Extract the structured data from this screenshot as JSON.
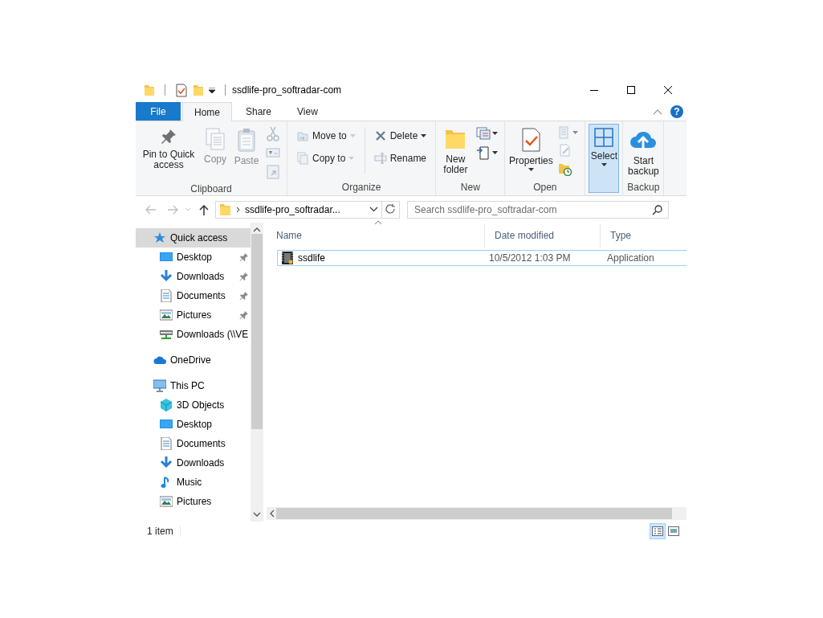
{
  "window": {
    "title": "ssdlife-pro_softradar-com"
  },
  "ribbon_tabs": [
    {
      "label": "File",
      "kind": "file",
      "selected": false
    },
    {
      "label": "Home",
      "kind": "tab",
      "selected": true
    },
    {
      "label": "Share",
      "kind": "tab",
      "selected": false
    },
    {
      "label": "View",
      "kind": "tab",
      "selected": false
    }
  ],
  "help_button": "?",
  "ribbon_groups": [
    {
      "label": "Clipboard",
      "commands": [
        {
          "kind": "large",
          "label": "Pin to Quick access",
          "disabled": false,
          "pressed": false,
          "dropdown": false
        },
        {
          "kind": "large",
          "label": "Copy",
          "disabled": true,
          "pressed": false,
          "dropdown": false
        },
        {
          "kind": "large",
          "label": "Paste",
          "disabled": true,
          "pressed": false,
          "dropdown": false
        },
        {
          "kind": "icon",
          "disabled": true,
          "pressed": false,
          "dropdown": false
        },
        {
          "kind": "icon",
          "disabled": true,
          "pressed": false,
          "dropdown": false
        },
        {
          "kind": "icon",
          "disabled": true,
          "pressed": false,
          "dropdown": false
        }
      ]
    },
    {
      "label": "Organize",
      "commands": [
        {
          "kind": "small",
          "label": "Move to",
          "disabled": true,
          "pressed": false,
          "dropdown": true
        },
        {
          "kind": "small",
          "label": "Copy to",
          "disabled": true,
          "pressed": false,
          "dropdown": true
        },
        {
          "kind": "small",
          "label": "Delete",
          "disabled": false,
          "pressed": false,
          "dropdown": true
        },
        {
          "kind": "small",
          "label": "Rename",
          "disabled": true,
          "pressed": false,
          "dropdown": false
        }
      ]
    },
    {
      "label": "New",
      "commands": [
        {
          "kind": "large",
          "label": "New folder",
          "disabled": false,
          "pressed": false,
          "dropdown": false
        },
        {
          "kind": "icon",
          "disabled": false,
          "pressed": false,
          "dropdown": true
        },
        {
          "kind": "icon",
          "disabled": false,
          "pressed": false,
          "dropdown": true
        }
      ]
    },
    {
      "label": "Open",
      "commands": [
        {
          "kind": "large",
          "label": "Properties",
          "disabled": false,
          "pressed": false,
          "dropdown": true
        },
        {
          "kind": "icon",
          "disabled": true,
          "pressed": false,
          "dropdown": true
        },
        {
          "kind": "icon",
          "disabled": true,
          "pressed": false,
          "dropdown": false
        },
        {
          "kind": "icon",
          "disabled": false,
          "pressed": false,
          "dropdown": false
        }
      ]
    },
    {
      "commands": [
        {
          "kind": "large",
          "label": "Select",
          "disabled": false,
          "pressed": true,
          "dropdown": true
        }
      ]
    },
    {
      "label": "Backup",
      "commands": [
        {
          "kind": "large",
          "label": "Start backup",
          "disabled": false,
          "pressed": false,
          "dropdown": false
        }
      ]
    }
  ],
  "address_bar": {
    "path": "ssdlife-pro_softradar..."
  },
  "search": {
    "placeholder": "Search ssdlife-pro_softradar-com"
  },
  "sidebar": {
    "items": [
      {
        "label": "Quick access",
        "kind": "quick",
        "selected": true,
        "pinned": false,
        "children": [
          {
            "label": "Desktop",
            "kind": "desktop",
            "selected": false,
            "pinned": true
          },
          {
            "label": "Downloads",
            "kind": "downloads",
            "selected": false,
            "pinned": true
          },
          {
            "label": "Documents",
            "kind": "documents",
            "selected": false,
            "pinned": true
          },
          {
            "label": "Pictures",
            "kind": "pictures",
            "selected": false,
            "pinned": true
          },
          {
            "label": "Downloads (\\\\VE",
            "kind": "network",
            "selected": false,
            "pinned": false
          }
        ]
      },
      {
        "label": "OneDrive",
        "kind": "onedrive",
        "selected": false,
        "pinned": false
      },
      {
        "label": "This PC",
        "kind": "pc",
        "selected": false,
        "pinned": false,
        "children": [
          {
            "label": "3D Objects",
            "kind": "objects",
            "selected": false,
            "pinned": false
          },
          {
            "label": "Desktop",
            "kind": "desktop",
            "selected": false,
            "pinned": false
          },
          {
            "label": "Documents",
            "kind": "documents",
            "selected": false,
            "pinned": false
          },
          {
            "label": "Downloads",
            "kind": "downloads",
            "selected": false,
            "pinned": false
          },
          {
            "label": "Music",
            "kind": "music",
            "selected": false,
            "pinned": false
          },
          {
            "label": "Pictures",
            "kind": "pictures",
            "selected": false,
            "pinned": false
          }
        ]
      }
    ]
  },
  "file_list": {
    "columns": [
      "Name",
      "Date modified",
      "Type"
    ],
    "rows": [
      {
        "name": "ssdlife",
        "date_modified": "10/5/2012 1:03 PM",
        "type": "Application",
        "selected": false,
        "focused": true
      }
    ]
  },
  "status_bar": {
    "item_count": "1 item",
    "views": [
      {
        "kind": "details",
        "selected": true
      },
      {
        "kind": "large",
        "selected": false
      }
    ]
  }
}
